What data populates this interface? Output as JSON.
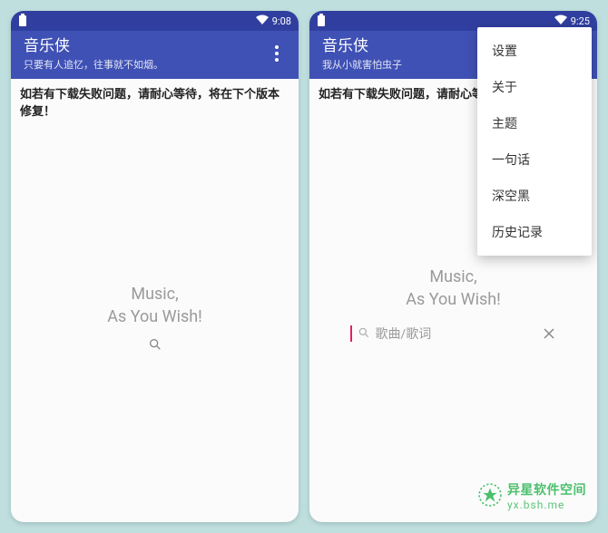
{
  "left": {
    "status": {
      "time": "9:08"
    },
    "appbar": {
      "title": "音乐侠",
      "subtitle": "只要有人追忆，往事就不如烟。"
    },
    "banner": "如若有下载失败问题，请耐心等待，将在下个版本修复！",
    "center": {
      "line1": "Music,",
      "line2": "As You Wish!"
    }
  },
  "right": {
    "status": {
      "time": "9:25"
    },
    "appbar": {
      "title": "音乐侠",
      "subtitle": "我从小就害怕虫子"
    },
    "banner": "如若有下载失败问题，请耐心等待",
    "center": {
      "line1": "Music,",
      "line2": "As You Wish!"
    },
    "search": {
      "placeholder": "歌曲/歌词"
    },
    "menu": [
      "设置",
      "关于",
      "主题",
      "一句话",
      "深空黑",
      "历史记录"
    ]
  },
  "watermark": {
    "title": "异星软件空间",
    "url": "yx.bsh.me"
  }
}
